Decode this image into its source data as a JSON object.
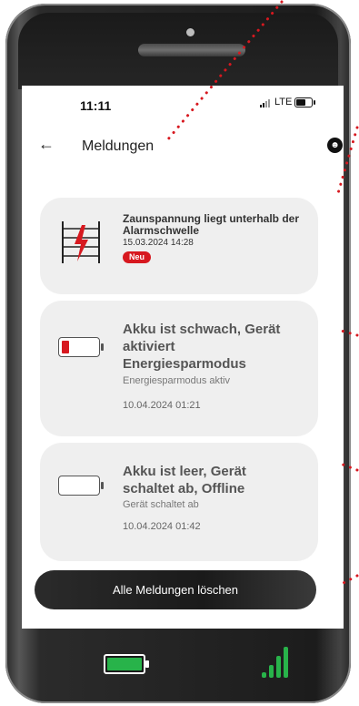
{
  "status_bar": {
    "time": "11:11",
    "network": "LTE"
  },
  "app_bar": {
    "title": "Meldungen"
  },
  "messages": [
    {
      "title": "Zaunspannung liegt unterhalb der Alarmschwelle",
      "date": "15.03.2024 14:28",
      "badge": "Neu",
      "icon": "fence-voltage-icon"
    },
    {
      "title": "Akku ist schwach, Gerät aktiviert Energiesparmodus",
      "status": "Energiesparmodus aktiv",
      "date": "10.04.2024 01:21",
      "icon": "battery-low-icon"
    },
    {
      "title": "Akku ist leer, Gerät schaltet ab, Offline",
      "status": "Gerät schaltet ab",
      "date": "10.04.2024 01:42",
      "icon": "battery-empty-icon"
    }
  ],
  "actions": {
    "delete_all": "Alle Meldungen löschen"
  },
  "device_indicators": {
    "battery_level": 1.0,
    "signal_bars": 4,
    "color": "#28b34a"
  },
  "colors": {
    "accent": "#d7181f",
    "card": "#efefef"
  }
}
